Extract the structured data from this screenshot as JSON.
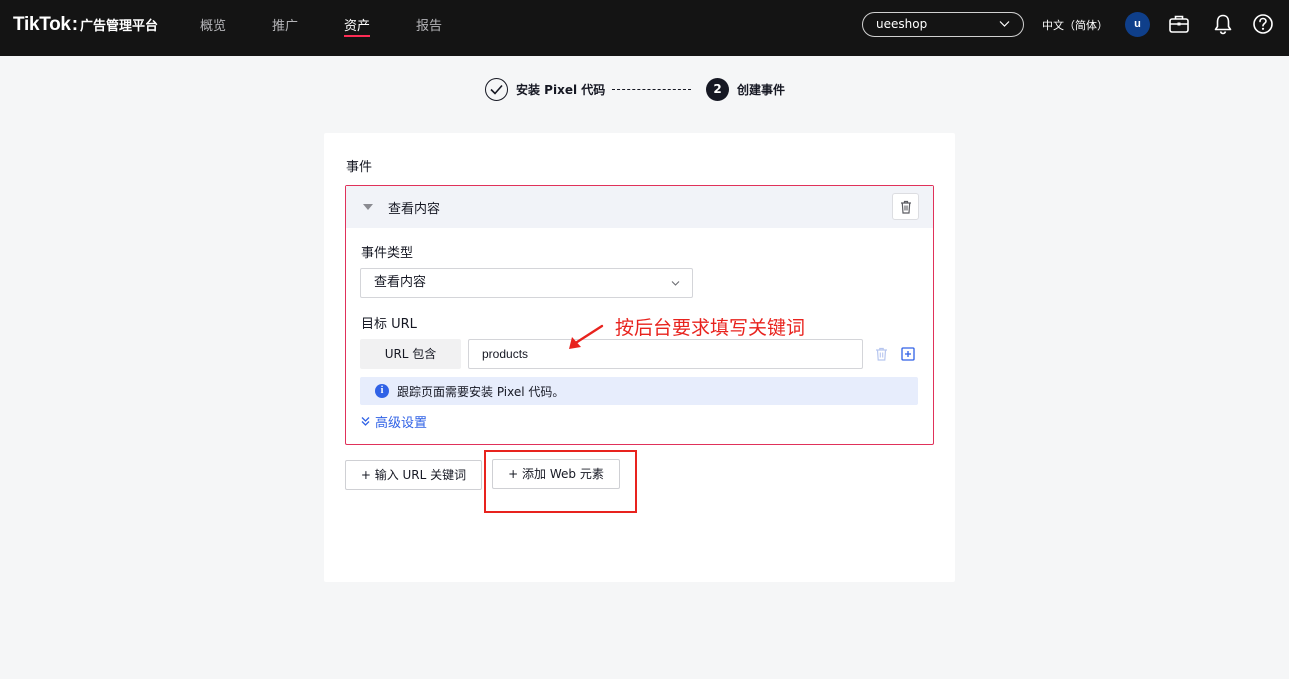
{
  "topbar": {
    "logo_main": "TikTok",
    "logo_colon": ":",
    "logo_sub": "广告管理平台",
    "nav": [
      {
        "label": "概览",
        "active": false
      },
      {
        "label": "推广",
        "active": false
      },
      {
        "label": "资产",
        "active": true
      },
      {
        "label": "报告",
        "active": false
      }
    ],
    "account": "ueeshop",
    "language": "中文（简体）",
    "avatar_letter": "u",
    "icons": [
      "briefcase-icon",
      "bell-icon",
      "help-icon"
    ]
  },
  "stepper": {
    "step1": "安装 Pixel 代码",
    "step2_number": "2",
    "step2": "创建事件"
  },
  "form": {
    "section_title": "事件",
    "event_name": "查看内容",
    "event_type_label": "事件类型",
    "event_type_value": "查看内容",
    "target_url_label": "目标 URL",
    "url_condition": "URL 包含",
    "url_value": "products",
    "info_text": "跟踪页面需要安装 Pixel 代码。",
    "advanced": "高级设置",
    "add_url_keyword": "+ 输入 URL 关键词",
    "add_web_element": "+ 添加 Web 元素"
  },
  "annotation": {
    "text": "按后台要求填写关键词",
    "color": "#e8231e"
  },
  "colors": {
    "brand": "#fe2c55",
    "topbar": "#141414",
    "link": "#3062e6",
    "error_border": "#e0315a"
  }
}
